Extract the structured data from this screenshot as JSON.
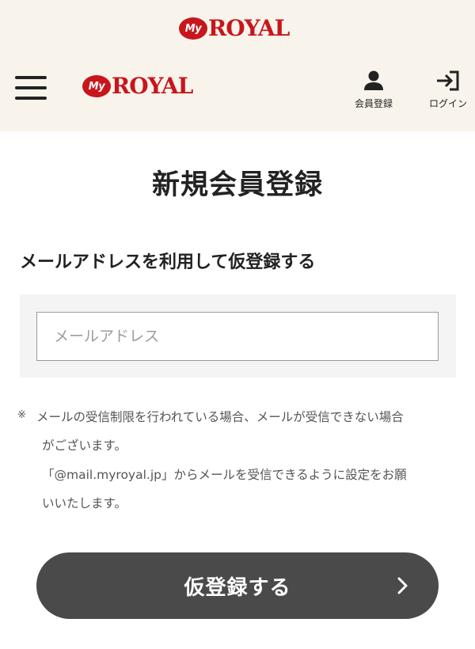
{
  "brand": {
    "badge": "My",
    "word": "ROYAL",
    "color": "#c8161d"
  },
  "nav": {
    "menu_icon": "hamburger-icon",
    "register_label": "会員登録",
    "register_icon": "person-icon",
    "login_label": "ログイン",
    "login_icon": "login-arrow-icon"
  },
  "page": {
    "title": "新規会員登録",
    "section_heading": "メールアドレスを利用して仮登録する",
    "email_placeholder": "メールアドレス",
    "email_value": ""
  },
  "notes": {
    "mark": "※",
    "line1": "メールの受信制限を行われている場合、メールが受信できない場合",
    "line2": "がございます。",
    "line3": "「@mail.myroyal.jp」からメールを受信できるように設定をお願",
    "line4": "いいたします。"
  },
  "submit": {
    "label": "仮登録する",
    "icon": "chevron-right-icon",
    "color": "#4a4a4a"
  },
  "colors": {
    "header_bg": "#f8f4ec",
    "panel_bg": "#f4f4f4"
  }
}
